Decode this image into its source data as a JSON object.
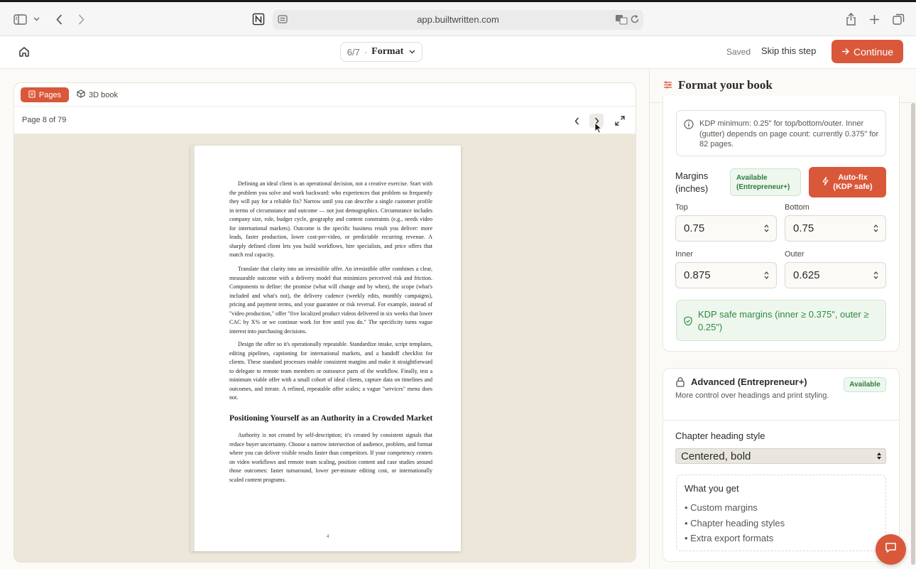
{
  "browser": {
    "url": "app.builtwritten.com",
    "icons": [
      "sidebar-icon",
      "chevron-down-icon",
      "back-icon",
      "forward-icon",
      "notion-icon",
      "site-settings-icon",
      "translate-icon",
      "reload-icon",
      "share-icon",
      "new-tab-icon",
      "tabs-overview-icon"
    ]
  },
  "header": {
    "step_count": "6/7",
    "step_separator": "·",
    "step_name": "Format",
    "saved_label": "Saved",
    "skip_label": "Skip this step",
    "continue_label": "Continue"
  },
  "preview": {
    "tabs": [
      {
        "label": "Pages",
        "active": true
      },
      {
        "label": "3D book",
        "active": false
      }
    ],
    "page_indicator": "Page 8 of 79",
    "book_page": {
      "paragraphs": [
        "Defining an ideal client is an operational decision, not a creative exercise. Start with the problem you solve and work backward: who experiences that problem so frequently they will pay for a reliable fix? Narrow until you can describe a single customer profile in terms of circumstance and outcome — not just demographics. Circumstance includes company size, role, budget cycle, geography and content constraints (e.g., needs video for international markets). Outcome is the specific business result you deliver: more leads, faster production, lower cost-per-video, or predictable recurring revenue. A sharply defined client lets you build workflows, hire specialists, and price offers that match real capacity.",
        "Translate that clarity into an irresistible offer. An irresistible offer combines a clear, measurable outcome with a delivery model that minimizes perceived risk and friction. Components to define: the promise (what will change and by when), the scope (what's included and what's not), the delivery cadence (weekly edits, monthly campaigns), pricing and payment terms, and your guarantee or risk reversal. For example, instead of \"video production,\" offer \"five localized product videos delivered in six weeks that lower CAC by X% or we continue work for free until you do.\" The specificity turns vague interest into purchasing decisions.",
        "Design the offer so it's operationally repeatable. Standardize intake, script templates, editing pipelines, captioning for international markets, and a handoff checklist for clients. These standard processes enable consistent margins and make it straightforward to delegate to remote team members or outsource parts of the workflow. Finally, test a minimum viable offer with a small cohort of ideal clients, capture data on timelines and outcomes, and iterate. A refined, repeatable offer scales; a vague \"services\" menu does not."
      ],
      "heading": "Positioning Yourself as an Authority in a Crowded Market",
      "heading_paragraph": "Authority is not created by self-description; it's created by consistent signals that reduce buyer uncertainty. Choose a narrow intersection of audience, problem, and format where you can deliver visible results faster than competitors. If your competency centers on video workflows and remote team scaling, position content and case studies around those outcomes: faster turnaround, lower per-minute editing cost, or internationally scaled content programs.",
      "folio": "4"
    }
  },
  "panel": {
    "title": "Format your book",
    "kdp_note": "KDP minimum: 0.25\" for top/bottom/outer. Inner (gutter) depends on page count: currently 0.375\" for 82 pages.",
    "margins_label": "Margins (inches)",
    "available_badge": "Available (Entrepreneur+)",
    "autofix_label": "Auto-fix (KDP safe)",
    "fields": {
      "top": {
        "label": "Top",
        "value": "0.75"
      },
      "bottom": {
        "label": "Bottom",
        "value": "0.75"
      },
      "inner": {
        "label": "Inner",
        "value": "0.875"
      },
      "outer": {
        "label": "Outer",
        "value": "0.625"
      }
    },
    "safe_message": "KDP safe margins (inner ≥ 0.375\", outer ≥ 0.25\")",
    "advanced": {
      "title": "Advanced (Entrepreneur+)",
      "badge": "Available",
      "description": "More control over headings and print styling.",
      "chapter_heading_label": "Chapter heading style",
      "chapter_heading_value": "Centered, bold",
      "what_you_get_title": "What you get",
      "what_you_get_items": [
        "• Custom margins",
        "• Chapter heading styles",
        "• Extra export formats"
      ]
    }
  },
  "colors": {
    "accent": "#d9583a",
    "success": "#2e8a40",
    "success_bg": "#eef7ee"
  }
}
